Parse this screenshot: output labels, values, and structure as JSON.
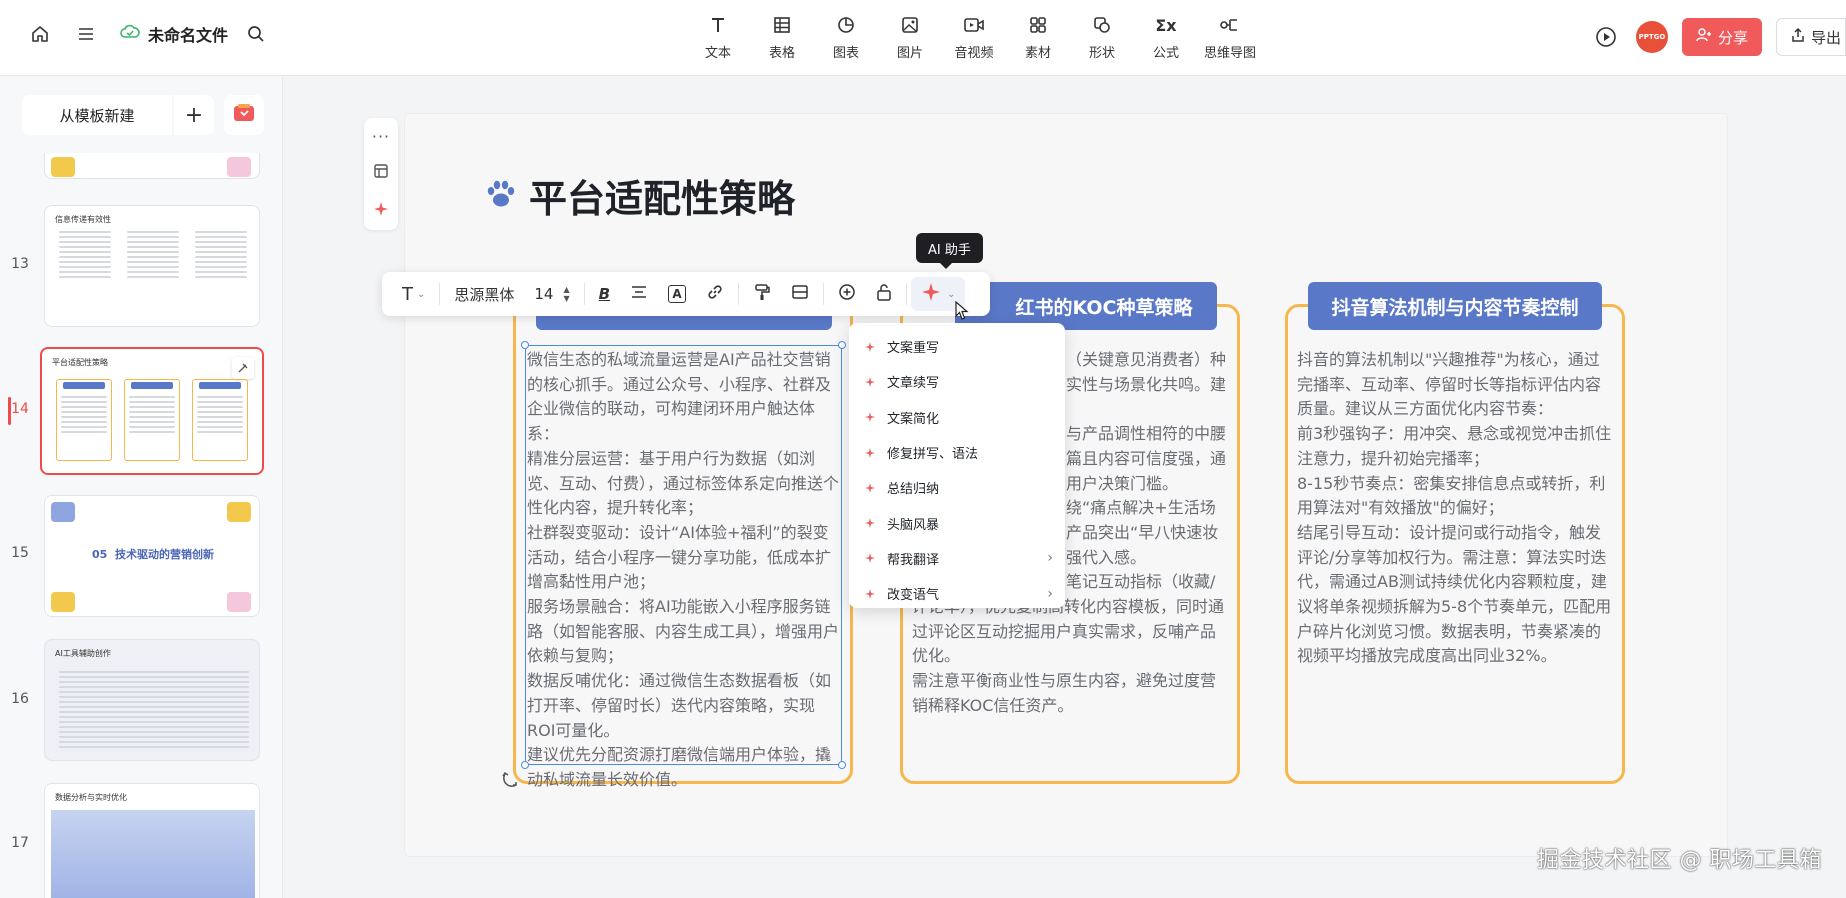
{
  "topbar": {
    "doc_title": "未命名文件",
    "tools": [
      {
        "label": "文本",
        "icon": "text-icon"
      },
      {
        "label": "表格",
        "icon": "table-icon"
      },
      {
        "label": "图表",
        "icon": "chart-icon"
      },
      {
        "label": "图片",
        "icon": "image-icon"
      },
      {
        "label": "音视频",
        "icon": "video-icon"
      },
      {
        "label": "素材",
        "icon": "assets-icon"
      },
      {
        "label": "形状",
        "icon": "shape-icon"
      },
      {
        "label": "公式",
        "icon": "formula-icon"
      },
      {
        "label": "思维导图",
        "icon": "mindmap-icon"
      }
    ],
    "avatar_text": "PPTGO",
    "share_label": "分享",
    "export_label": "导出"
  },
  "sidebar": {
    "new_template_label": "从模板新建",
    "plus_label": "+",
    "slides": [
      {
        "num": "13",
        "title": "信息传递有效性"
      },
      {
        "num": "14",
        "title": "平台适配性策略"
      },
      {
        "num": "15",
        "title": "05  技术驱动的营销创新"
      },
      {
        "num": "16",
        "title": "AI工具辅助创作"
      },
      {
        "num": "17",
        "title": "数据分析与实时优化"
      }
    ]
  },
  "slide": {
    "title": "平台适配性策略",
    "cards": [
      {
        "heading": "",
        "paragraphs": [
          "微信生态的私域流量运营是AI产品社交营销的核心抓手。通过公众号、小程序、社群及企业微信的联动，可构建闭环用户触达体系：",
          "精准分层运营：基于用户行为数据（如浏览、互动、付费），通过标签体系定向推送个性化内容，提升转化率；",
          "社群裂变驱动：设计“AI体验+福利”的裂变活动，结合小程序一键分享功能，低成本扩增高黏性用户池；",
          "服务场景融合：将AI功能嵌入小程序服务链路（如智能客服、内容生成工具），增强用户依赖与复购；",
          "数据反哺优化：通过微信生态数据看板（如打开率、停留时长）迭代内容策略，实现ROI可量化。",
          "建议优先分配资源打磨微信端用户体验，撬动私域流量长效价值。"
        ]
      },
      {
        "heading": "红书的KOC种草策略",
        "paragraphs": [
          "（关键意见消费者）种",
          "实性与场景化共鸣。建",
          "与产品调性相符的中腰",
          "篇且内容可信度强，通",
          "用户决策门槛。",
          "绕“痛点解决+生活场",
          "产品突出“早八快速妆",
          "强代入感。",
          "笔记互动指标（收藏/",
          "评论率），优先复制高转化内容模板，同时通过评论区互动挖掘用户真实需求，反哺产品优化。",
          "需注意平衡商业性与原生内容，避免过度营销稀释KOC信任资产。"
        ]
      },
      {
        "heading": "抖音算法机制与内容节奏控制",
        "paragraphs": [
          "抖音的算法机制以\"兴趣推荐\"为核心，通过完播率、互动率、停留时长等指标评估内容质量。建议从三方面优化内容节奏：",
          "前3秒强钩子：用冲突、悬念或视觉冲击抓住注意力，提升初始完播率；",
          "8-15秒节奏点：密集安排信息点或转折，利用算法对\"有效播放\"的偏好；",
          "结尾引导互动：设计提问或行动指令，触发评论/分享等加权行为。需注意：算法实时迭代，需通过AB测试持续优化内容颗粒度，建议将单条视频拆解为5-8个节奏单元，匹配用户碎片化浏览习惯。数据表明，节奏紧凑的视频平均播放完成度高出同业32%。"
        ]
      }
    ]
  },
  "format_toolbar": {
    "font_name": "思源黑体",
    "font_size": "14"
  },
  "tooltip": "AI 助手",
  "ai_menu": {
    "items": [
      {
        "label": "文案重写",
        "submenu": false
      },
      {
        "label": "文章续写",
        "submenu": false
      },
      {
        "label": "文案简化",
        "submenu": false
      },
      {
        "label": "修复拼写、语法",
        "submenu": false
      },
      {
        "label": "总结归纳",
        "submenu": false
      },
      {
        "label": "头脑风暴",
        "submenu": false
      },
      {
        "label": "帮我翻译",
        "submenu": true
      },
      {
        "label": "改变语气",
        "submenu": true
      }
    ]
  },
  "watermark": "掘金技术社区 @ 职场工具箱",
  "colors": {
    "accent_red": "#ef4b4b",
    "card_border": "#f5b74e",
    "card_heading": "#5a78c8",
    "selection": "#4a8ae6"
  }
}
